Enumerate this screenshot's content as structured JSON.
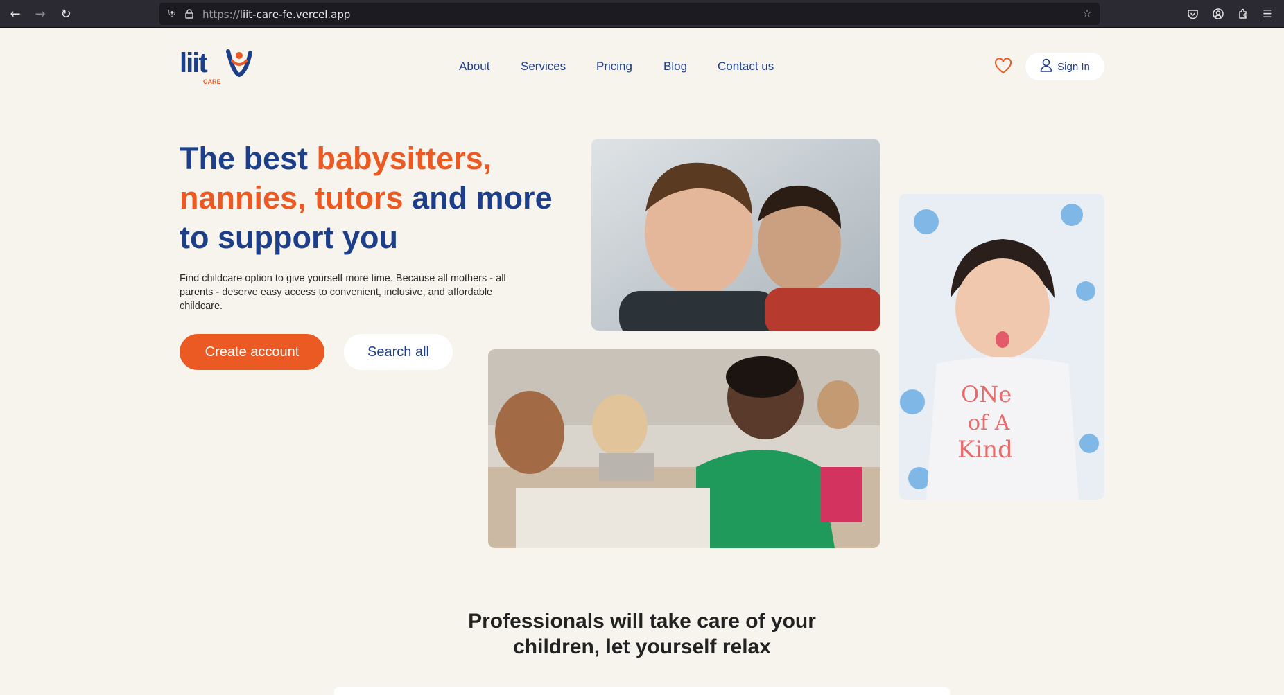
{
  "browser": {
    "url_protocol": "https://",
    "url_host": "liit-care-fe.vercel.app",
    "back_icon": "arrow-left-icon",
    "forward_icon": "arrow-right-icon",
    "reload_icon": "reload-icon"
  },
  "header": {
    "logo_text": "liit",
    "logo_sub": "CARE",
    "nav": [
      {
        "label": "About"
      },
      {
        "label": "Services"
      },
      {
        "label": "Pricing"
      },
      {
        "label": "Blog"
      },
      {
        "label": "Contact us"
      }
    ],
    "signin_label": "Sign In"
  },
  "hero": {
    "title_part1": "The best ",
    "title_accent": "babysitters, nannies, tutors",
    "title_part2": " and more to support you",
    "description": "Find childcare option to give yourself more time. Because all mothers - all parents - deserve easy access to convenient, inclusive, and affordable childcare.",
    "create_account_label": "Create account",
    "search_all_label": "Search all"
  },
  "section": {
    "title": "Professionals will take care of your children, let yourself relax"
  },
  "colors": {
    "brand_blue": "#1d3f8a",
    "brand_orange": "#ec5a24",
    "background": "#f7f4ee"
  }
}
